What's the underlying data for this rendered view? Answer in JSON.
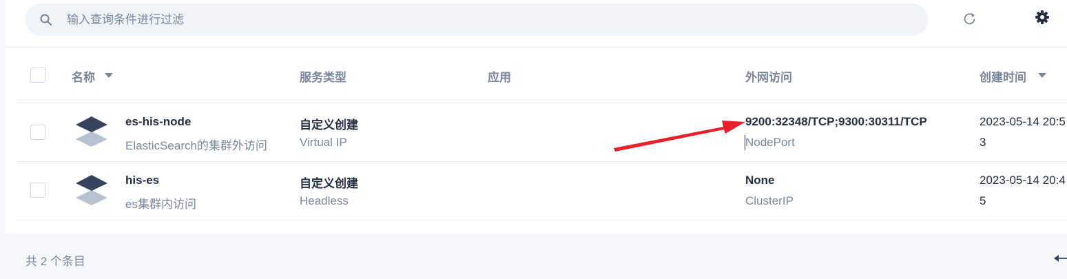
{
  "toolbar": {
    "search_placeholder": "输入查询条件进行过滤",
    "search_icon": "search-icon",
    "refresh_icon": "refresh-icon",
    "settings_icon": "gear-icon"
  },
  "table": {
    "columns": {
      "name": "名称",
      "service_type": "服务类型",
      "app": "应用",
      "external_access": "外网访问",
      "created_time": "创建时间"
    },
    "rows": [
      {
        "name": "es-his-node",
        "description": "ElasticSearch的集群外访问",
        "service_type": "自定义创建",
        "service_subtype": "Virtual IP",
        "app": "",
        "external_access": "9200:32348/TCP;9300:30311/TCP",
        "access_type": "NodePort",
        "created_time": "2023-05-14 20:5",
        "created_sub": "3"
      },
      {
        "name": "his-es",
        "description": "es集群内访问",
        "service_type": "自定义创建",
        "service_subtype": "Headless",
        "app": "",
        "external_access": "None",
        "access_type": "ClusterIP",
        "created_time": "2023-05-14 20:4",
        "created_sub": "5"
      }
    ]
  },
  "footer": {
    "total_label": "共 2 个条目"
  },
  "colors": {
    "text_primary": "#242e42",
    "text_secondary": "#79879c",
    "icon_dark": "#36435c",
    "icon_light": "#b7c2d0",
    "annotation_arrow": "#e8202a"
  }
}
